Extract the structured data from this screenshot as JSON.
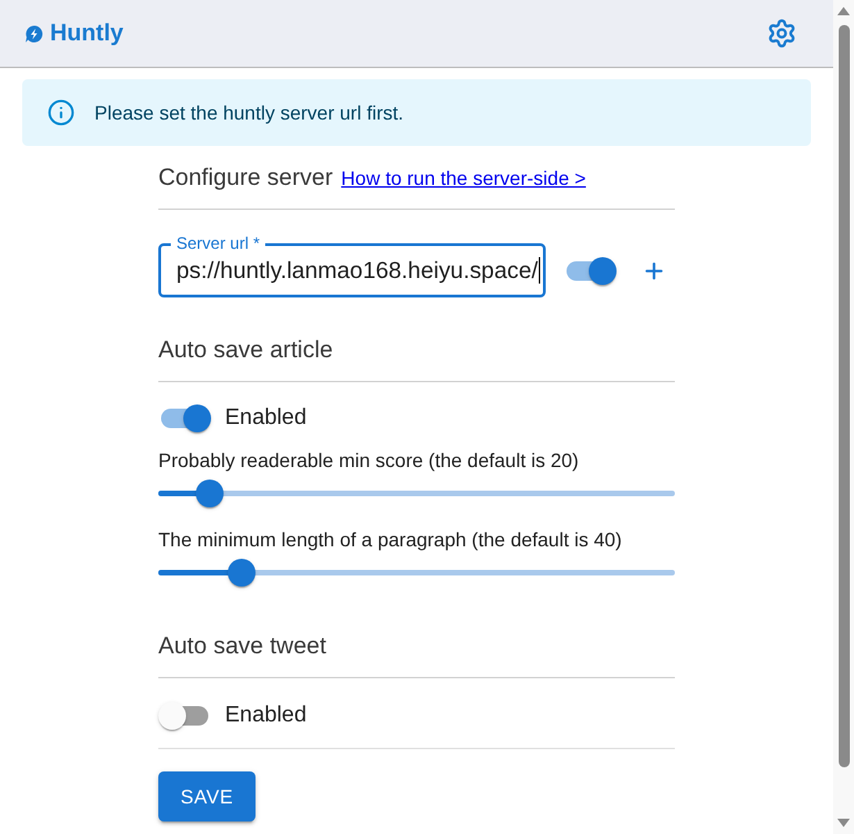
{
  "header": {
    "title": "Huntly"
  },
  "alert": {
    "message": "Please set the huntly server url first."
  },
  "configure_server": {
    "heading": "Configure server",
    "link": "How to run the server-side >",
    "server": {
      "label": "Server url *",
      "value": "ps://huntly.lanmao168.heiyu.space/",
      "focused": true,
      "on": true
    }
  },
  "auto_save_article": {
    "heading": "Auto save article",
    "toggle": {
      "label": "Enabled",
      "on": true
    },
    "sliders": [
      {
        "label": "Probably readerable min score (the default is 20)",
        "level": 0.1
      },
      {
        "label": "The minimum length of a paragraph (the default is 40)",
        "level": 0.16
      }
    ]
  },
  "auto_save_tweet": {
    "heading": "Auto save tweet",
    "toggle": {
      "label": "Enabled",
      "on": false
    }
  },
  "save_button": "SAVE"
}
